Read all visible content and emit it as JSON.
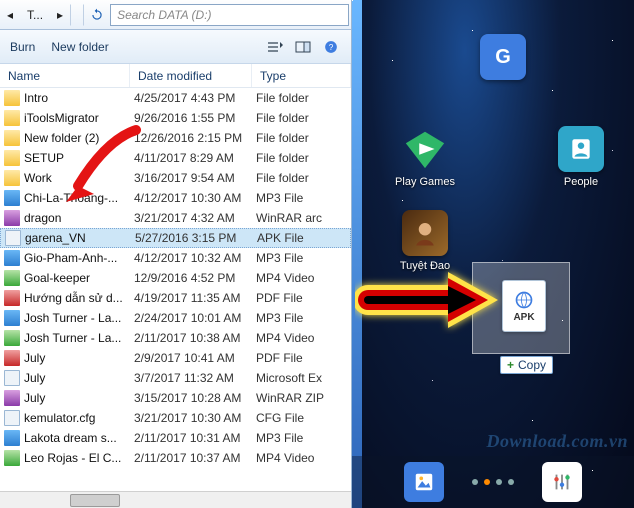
{
  "nav": {
    "crumb_suffix": "T...",
    "refresh_icon": "refresh-icon",
    "search_placeholder": "Search DATA (D:)"
  },
  "toolbar": {
    "burn": "Burn",
    "new_folder": "New folder"
  },
  "columns": {
    "name": "Name",
    "date": "Date modified",
    "type": "Type"
  },
  "files": [
    {
      "name": "Intro",
      "date": "4/25/2017 4:43 PM",
      "type": "File folder",
      "icon": "ico-folder"
    },
    {
      "name": "iToolsMigrator",
      "date": "9/26/2016 1:55 PM",
      "type": "File folder",
      "icon": "ico-folder"
    },
    {
      "name": "New folder (2)",
      "date": "12/26/2016 2:15 PM",
      "type": "File folder",
      "icon": "ico-folder"
    },
    {
      "name": "SETUP",
      "date": "4/11/2017 8:29 AM",
      "type": "File folder",
      "icon": "ico-folder"
    },
    {
      "name": "Work",
      "date": "3/16/2017 9:54 AM",
      "type": "File folder",
      "icon": "ico-folder"
    },
    {
      "name": "Chi-La-Thoang-...",
      "date": "4/12/2017 10:30 AM",
      "type": "MP3 File",
      "icon": "ico-mp3"
    },
    {
      "name": "dragon",
      "date": "3/21/2017 4:32 AM",
      "type": "WinRAR arc",
      "icon": "ico-rar"
    },
    {
      "name": "garena_VN",
      "date": "5/27/2016 3:15 PM",
      "type": "APK File",
      "icon": "ico-apk",
      "selected": true
    },
    {
      "name": "Gio-Pham-Anh-...",
      "date": "4/12/2017 10:32 AM",
      "type": "MP3 File",
      "icon": "ico-mp3"
    },
    {
      "name": "Goal-keeper",
      "date": "12/9/2016 4:52 PM",
      "type": "MP4 Video",
      "icon": "ico-mp4"
    },
    {
      "name": "Hướng dẫn sử d...",
      "date": "4/19/2017 11:35 AM",
      "type": "PDF File",
      "icon": "ico-pdf"
    },
    {
      "name": "Josh Turner - La...",
      "date": "2/24/2017 10:01 AM",
      "type": "MP3 File",
      "icon": "ico-mp3"
    },
    {
      "name": "Josh Turner - La...",
      "date": "2/11/2017 10:38 AM",
      "type": "MP4 Video",
      "icon": "ico-mp4"
    },
    {
      "name": "July",
      "date": "2/9/2017 10:41 AM",
      "type": "PDF File",
      "icon": "ico-pdf"
    },
    {
      "name": "July",
      "date": "3/7/2017 11:32 AM",
      "type": "Microsoft Ex",
      "icon": "ico-doc"
    },
    {
      "name": "July",
      "date": "3/15/2017 10:28 AM",
      "type": "WinRAR ZIP",
      "icon": "ico-rar"
    },
    {
      "name": "kemulator.cfg",
      "date": "3/21/2017 10:30 AM",
      "type": "CFG File",
      "icon": "ico-cfg"
    },
    {
      "name": "Lakota dream s...",
      "date": "2/11/2017 10:31 AM",
      "type": "MP3 File",
      "icon": "ico-mp3"
    },
    {
      "name": "Leo Rojas - El C...",
      "date": "2/11/2017 10:37 AM",
      "type": "MP4 Video",
      "icon": "ico-mp4"
    }
  ],
  "emu": {
    "apps": {
      "g": {
        "label": "",
        "color": "#3e7de0"
      },
      "playgames": {
        "label": "Play Games"
      },
      "people": {
        "label": "People"
      },
      "tuyetdao": {
        "label": "Tuyệt Đao"
      }
    },
    "apk_badge": "APK",
    "copy_tag": "Copy",
    "watermark": "Download.com.vn"
  }
}
